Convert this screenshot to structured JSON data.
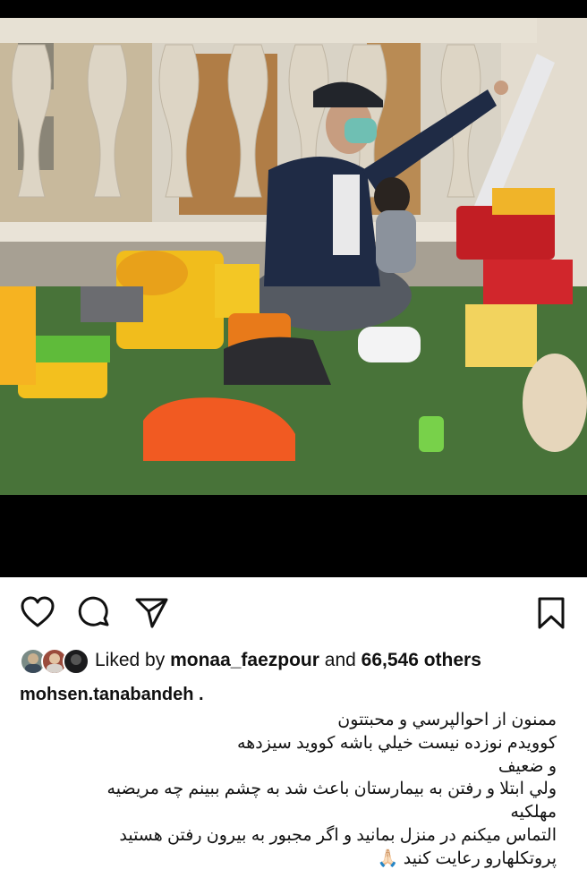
{
  "post": {
    "actions": {
      "like_icon": "heart-outline",
      "comment_icon": "speech-bubble",
      "share_icon": "paper-plane",
      "save_icon": "bookmark-outline"
    },
    "likes": {
      "prefix": "Liked by ",
      "user": "monaa_faezpour",
      "middle": " and ",
      "count": "66,546 others"
    },
    "username": "mohsen.tanabandeh .",
    "caption_lines": [
      "ممنون از احوالپرسي و محبتتون",
      "کوويدم نوزده نيست خيلي باشه کوويد سيزدهه",
      "و ضعيف",
      "ولي ابتلا و رفتن به بيمارستان باعث شد به چشم ببينم چه مريضيه",
      "مهلکيه",
      "التماس ميکنم در منزل بمانيد و اگر مجبور به بيرون رفتن هستيد",
      "پروتکلهارو رعايت کنيد 🙏🏻"
    ]
  },
  "colors": {
    "background": "#ffffff",
    "text": "#111111",
    "black": "#000000"
  }
}
